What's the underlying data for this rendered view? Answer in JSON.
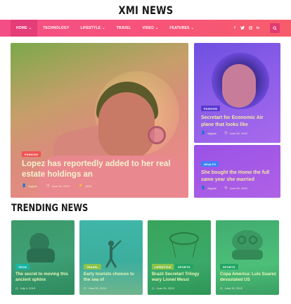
{
  "site": {
    "logo": "XMI NEWS"
  },
  "nav": {
    "items": [
      {
        "label": "HOME",
        "has_dropdown": true,
        "active": true
      },
      {
        "label": "TECHNOLOGY",
        "has_dropdown": false,
        "active": false
      },
      {
        "label": "LIFESTYLE",
        "has_dropdown": true,
        "active": false
      },
      {
        "label": "TRAVEL",
        "has_dropdown": false,
        "active": false
      },
      {
        "label": "VIDEO",
        "has_dropdown": true,
        "active": false
      },
      {
        "label": "FEATURES",
        "has_dropdown": true,
        "active": false
      }
    ],
    "socials": [
      "f",
      "t",
      "ig",
      "in"
    ],
    "search_icon": "search-icon",
    "accent": "#f7537a"
  },
  "hero": {
    "category": "FASHION",
    "title": "Lopez has reportedly added to her real estate holdings an",
    "author": "digipde",
    "date": "June 30, 2019",
    "views": "3618"
  },
  "side": [
    {
      "category": "FASHION",
      "title": "Secretart for Economic Air plane that looks like",
      "author": "digipde",
      "date": "June 30, 2019"
    },
    {
      "category": "HEALTH",
      "title": "She bought the Home the full same year she married",
      "author": "digipde",
      "date": "June 30, 2019"
    }
  ],
  "trending": {
    "heading": "TRENDING NEWS",
    "items": [
      {
        "categories": [
          "TECH"
        ],
        "title": "The secret to moving this ancient sphinx",
        "date": "July 4, 2019"
      },
      {
        "categories": [
          "TRAVEL"
        ],
        "title": "Early tourists choices to the sea of",
        "date": "June 30, 2019"
      },
      {
        "categories": [
          "LIFESTYLE",
          "SPORTS"
        ],
        "title": "Brazil Secretart Trilogy wary Lionel Messi",
        "date": "June 30, 2019"
      },
      {
        "categories": [
          "SPORTS"
        ],
        "title": "Copa America: Luis Suarez devastated US",
        "date": "June 30, 2019"
      }
    ]
  }
}
